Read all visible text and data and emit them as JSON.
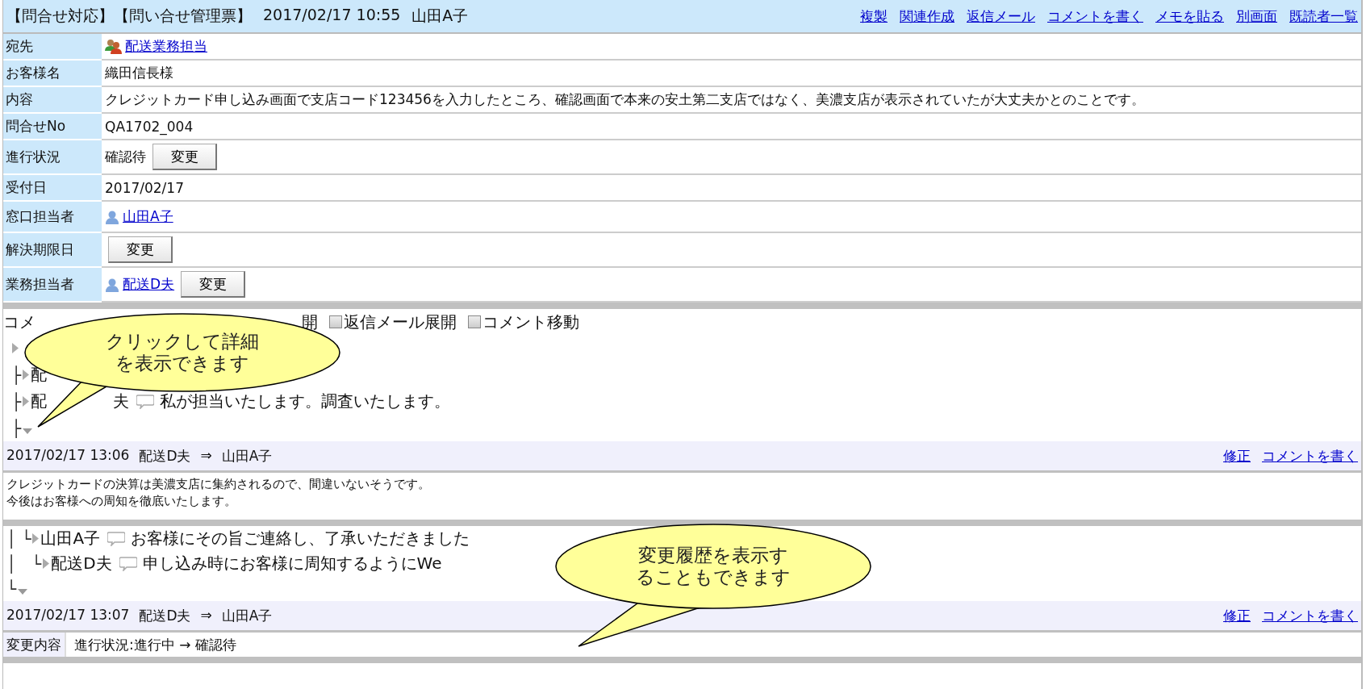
{
  "header": {
    "title": "【問合せ対応】【問い合せ管理票】",
    "datetime": "2017/02/17 10:55",
    "author": "山田A子",
    "links": [
      "複製",
      "関連作成",
      "返信メール",
      "コメントを書く",
      "メモを貼る",
      "別画面",
      "既読者一覧"
    ]
  },
  "fields": [
    {
      "label": "宛先",
      "kind": "group-link",
      "value": "配送業務担当"
    },
    {
      "label": "お客様名",
      "kind": "text",
      "value": "織田信長様"
    },
    {
      "label": "内容",
      "kind": "text",
      "value": "クレジットカード申し込み画面で支店コード123456を入力したところ、確認画面で本来の安土第二支店ではなく、美濃支店が表示されていたが大丈夫かとのことです。"
    },
    {
      "label": "問合せNo",
      "kind": "text",
      "value": "QA1702_004"
    },
    {
      "label": "進行状況",
      "kind": "text",
      "value": "確認待",
      "button": "変更"
    },
    {
      "label": "受付日",
      "kind": "text",
      "value": "2017/02/17"
    },
    {
      "label": "窓口担当者",
      "kind": "user-link",
      "value": "山田A子"
    },
    {
      "label": "解決期限日",
      "kind": "empty",
      "button": "変更"
    },
    {
      "label": "業務担当者",
      "kind": "user-link",
      "value": "配送D夫",
      "button": "変更"
    }
  ],
  "thread_options": {
    "fragments": [
      "コメ",
      "開"
    ],
    "checkboxes": [
      {
        "label": "返信メール展開",
        "checked": false
      },
      {
        "label": "コメント移動",
        "checked": false
      }
    ]
  },
  "sections": [
    {
      "tree": [
        {
          "expanded": false
        },
        {
          "branch": "├",
          "expanded": false,
          "author": "配"
        },
        {
          "branch": "├",
          "expanded": false,
          "author": "配",
          "author_tail": "夫",
          "message": "私が担当いたします。調査いたします。"
        },
        {
          "branch": "├",
          "expanded": true
        }
      ],
      "entry": {
        "kind": "comment",
        "timestamp": "2017/02/17 13:06",
        "from": "配送D夫",
        "arrow": "⇒",
        "to": "山田A子",
        "actions": [
          "修正",
          "コメントを書く"
        ],
        "body": [
          "クレジットカードの決算は美濃支店に集約されるので、間違いないそうです。",
          "今後はお客様への周知を徹底いたします。"
        ]
      }
    },
    {
      "tree": [
        {
          "branch": "│ └",
          "expanded": false,
          "author": "山田A子",
          "message": "お客様にその旨ご連絡し、了承いただきました"
        },
        {
          "branch": "│   └",
          "expanded": false,
          "author": "配送D夫",
          "message": "申し込み時にお客様に周知するようにWe"
        },
        {
          "branch": "└",
          "expanded": true
        }
      ],
      "entry": {
        "kind": "change",
        "timestamp": "2017/02/17 13:07",
        "from": "配送D夫",
        "arrow": "⇒",
        "to": "山田A子",
        "actions": [
          "修正",
          "コメントを書く"
        ],
        "change_label": "変更内容",
        "change_text": "進行状況:進行中 → 確認待"
      }
    }
  ],
  "callouts": [
    {
      "lines": [
        "クリックして詳細",
        "を表示できます"
      ]
    },
    {
      "lines": [
        "変更履歴を表示す",
        "ることもできます"
      ]
    }
  ]
}
